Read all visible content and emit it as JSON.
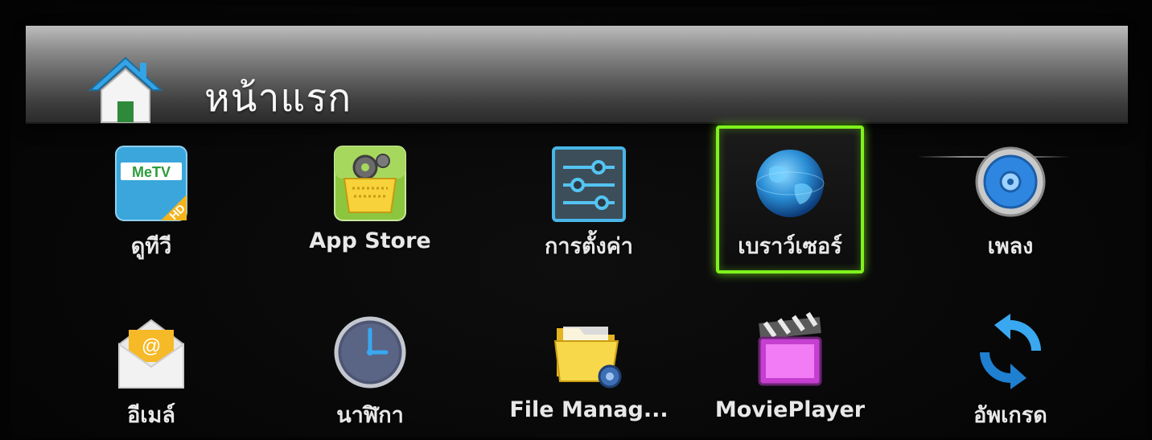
{
  "header": {
    "title": "หน้าแรก",
    "icon": "home-icon"
  },
  "apps": [
    {
      "label": "ดูทีวี",
      "icon": "metv-hd-icon",
      "selected": false
    },
    {
      "label": "App Store",
      "icon": "app-store-basket-icon",
      "selected": false
    },
    {
      "label": "การตั้งค่า",
      "icon": "settings-sliders-icon",
      "selected": false
    },
    {
      "label": "เบราว์เซอร์",
      "icon": "globe-browser-icon",
      "selected": true
    },
    {
      "label": "เพลง",
      "icon": "music-speaker-icon",
      "selected": false
    },
    {
      "label": "อีเมล์",
      "icon": "email-envelope-icon",
      "selected": false
    },
    {
      "label": "นาฬิกา",
      "icon": "clock-icon",
      "selected": false
    },
    {
      "label": "File Manag...",
      "icon": "file-manager-folder-icon",
      "selected": false
    },
    {
      "label": "MoviePlayer",
      "icon": "movie-clapper-icon",
      "selected": false
    },
    {
      "label": "อัพเกรด",
      "icon": "upgrade-sync-icon",
      "selected": false
    }
  ],
  "metv_logo_text": "MeTV",
  "metv_badge_text": "HD",
  "colors": {
    "selection": "#7ff21d",
    "header_top": "#bdbdbd",
    "header_bottom": "#2b2b2b",
    "label": "#e8e8e8"
  }
}
